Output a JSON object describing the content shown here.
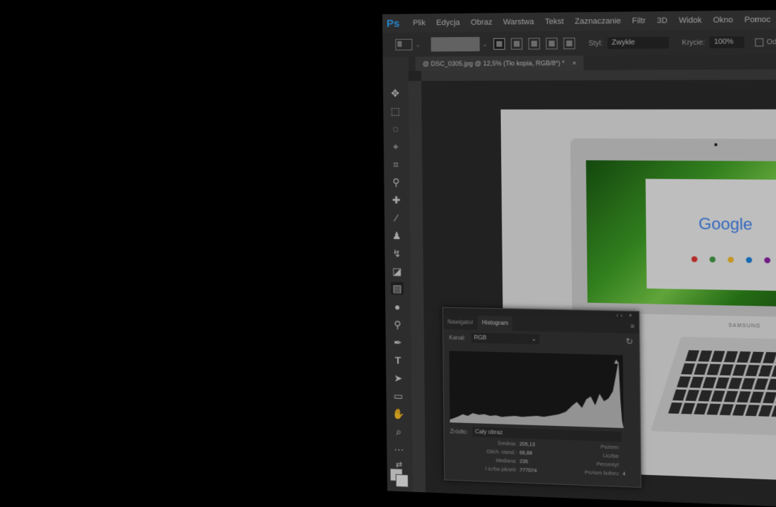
{
  "app": {
    "logo": "Ps"
  },
  "menu": [
    "Plik",
    "Edycja",
    "Obraz",
    "Warstwa",
    "Tekst",
    "Zaznaczanie",
    "Filtr",
    "3D",
    "Widok",
    "Okno",
    "Pomoc"
  ],
  "options": {
    "style_label": "Styl:",
    "style_value": "Zwykłe",
    "width_label": "Krycie:",
    "width_value": "100%",
    "extra_label": "Odbij"
  },
  "document": {
    "tab": "@ DSC_0305.jpg @ 12,5% (Tło kopia, RGB/8*) *",
    "close": "×"
  },
  "photo": {
    "google": "Google",
    "brand": "SAMSUNG"
  },
  "histogram_panel": {
    "tabs": [
      "Nawigator",
      "Histogram"
    ],
    "channel_label": "Kanał:",
    "channel_value": "RGB",
    "source_label": "Źródło:",
    "source_value": "Cały obraz",
    "stats_left": [
      {
        "label": "Średnia:",
        "value": "205,13"
      },
      {
        "label": "Odch. stand.:",
        "value": "66,88"
      },
      {
        "label": "Mediana:",
        "value": "235"
      },
      {
        "label": "Liczba pikseli:",
        "value": "277024"
      }
    ],
    "stats_right": [
      {
        "label": "Poziom:",
        "value": ""
      },
      {
        "label": "Liczba:",
        "value": ""
      },
      {
        "label": "Percentyl:",
        "value": ""
      },
      {
        "label": "Poziom buforu:",
        "value": "4"
      }
    ]
  }
}
